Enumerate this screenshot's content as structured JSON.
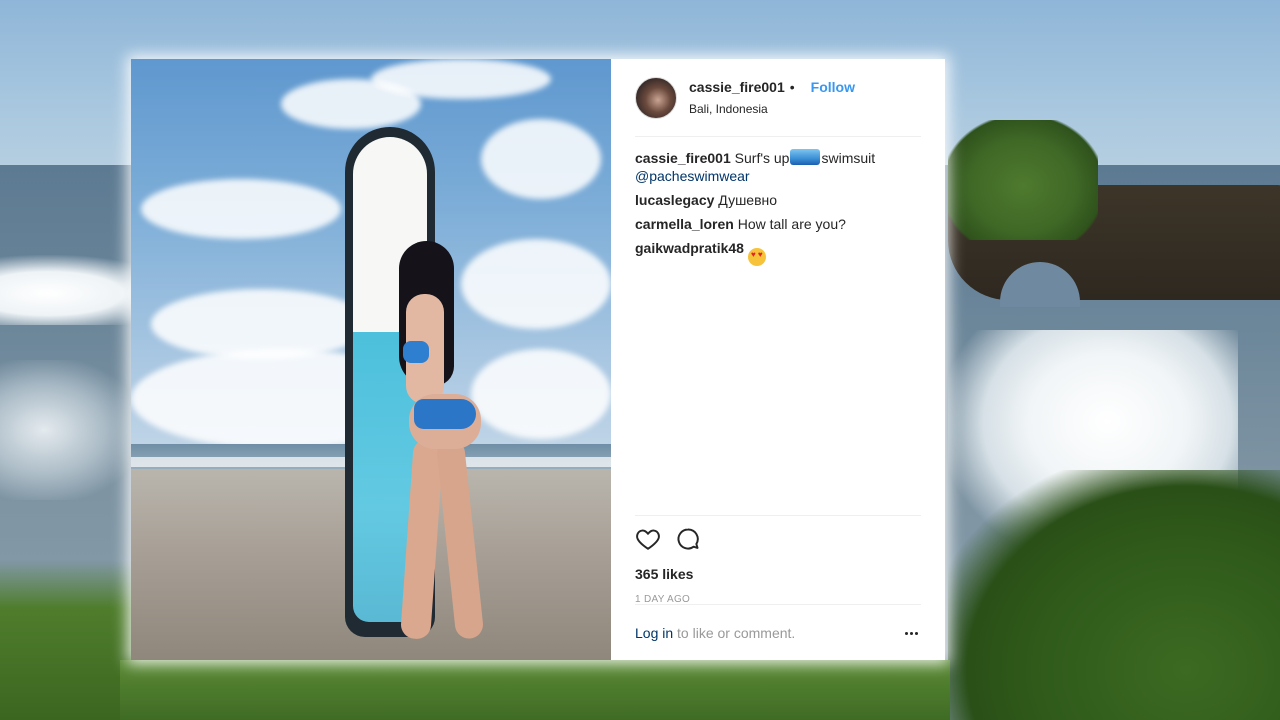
{
  "post": {
    "username": "cassie_fire001",
    "dot": "•",
    "follow_label": "Follow",
    "location": "Bali, Indonesia",
    "caption": {
      "user": "cassie_fire001",
      "text_before_emoji": "Surf's up",
      "emoji": "surfer-wave-emoji",
      "text_after_emoji": "swimsuit",
      "mention": "@pacheswimwear"
    },
    "comments": [
      {
        "user": "lucaslegacy",
        "text": "Душевно"
      },
      {
        "user": "carmella_loren",
        "text": "How tall are you?"
      },
      {
        "user": "gaikwadpratik48",
        "text": "",
        "emoji": "heart-eyes-emoji"
      }
    ],
    "likes": "365 likes",
    "time": "1 DAY AGO",
    "footer": {
      "login_label": "Log in",
      "rest": " to like or comment."
    },
    "icons": {
      "like": "heart-outline-icon",
      "comment": "comment-bubble-icon",
      "more": "more-options-icon"
    }
  },
  "colors": {
    "link_blue": "#3897f0",
    "mention_blue": "#003569",
    "text": "#262626",
    "muted": "#999999"
  }
}
